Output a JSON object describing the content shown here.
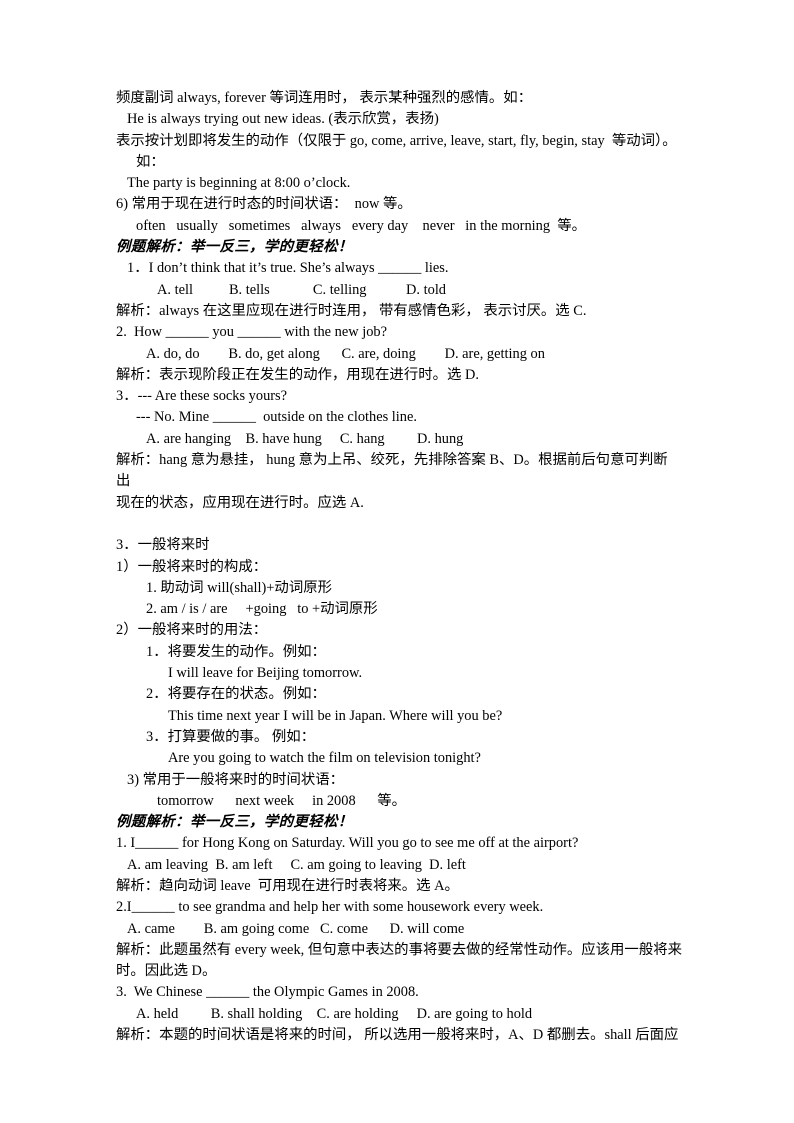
{
  "document": {
    "language": "zh-CN + en",
    "lines": [
      {
        "id": "l01",
        "indent": 0,
        "style": "normal",
        "text": "频度副词 always, forever 等词连用时， 表示某种强烈的感情。如："
      },
      {
        "id": "l02",
        "indent": 1,
        "style": "normal",
        "text": "He is always trying out new ideas. (表示欣赏，表扬)"
      },
      {
        "id": "l03",
        "indent": 0,
        "style": "normal",
        "text": "表示按计划即将发生的动作（仅限于 go, come, arrive, leave, start, fly, begin, stay  等动词）。"
      },
      {
        "id": "l04",
        "indent": 2,
        "style": "normal",
        "text": "如："
      },
      {
        "id": "l05",
        "indent": 1,
        "style": "normal",
        "text": "The party is beginning at 8:00 o’clock."
      },
      {
        "id": "l06",
        "indent": 0,
        "style": "normal",
        "text": "6) 常用于现在进行时态的时间状语：  now 等。"
      },
      {
        "id": "l07",
        "indent": 2,
        "style": "normal",
        "text": "often   usually   sometimes   always   every day    never   in the morning  等。"
      },
      {
        "id": "l08",
        "indent": 0,
        "style": "heading",
        "text": "例题解析：举一反三，学的更轻松！"
      },
      {
        "id": "l09",
        "indent": 1,
        "style": "normal",
        "text": "1．I don’t think that it’s true. She’s always ______ lies."
      },
      {
        "id": "l10",
        "indent": 4,
        "style": "normal",
        "text": "A. tell          B. tells            C. telling           D. told"
      },
      {
        "id": "l11",
        "indent": 0,
        "style": "normal",
        "text": "解析：always 在这里应现在进行时连用， 带有感情色彩， 表示讨厌。选 C."
      },
      {
        "id": "l12",
        "indent": 0,
        "style": "normal",
        "text": "2.  How ______ you ______ with the new job?"
      },
      {
        "id": "l13",
        "indent": 3,
        "style": "normal",
        "text": "A. do, do        B. do, get along      C. are, doing        D. are, getting on"
      },
      {
        "id": "l14",
        "indent": 0,
        "style": "normal",
        "text": "解析：表示现阶段正在发生的动作，用现在进行时。选 D."
      },
      {
        "id": "l15",
        "indent": 0,
        "style": "normal",
        "text": "3．--- Are these socks yours?"
      },
      {
        "id": "l16",
        "indent": 2,
        "style": "normal",
        "text": "--- No. Mine ______  outside on the clothes line."
      },
      {
        "id": "l17",
        "indent": 3,
        "style": "normal",
        "text": "A. are hanging    B. have hung     C. hang         D. hung"
      },
      {
        "id": "l18",
        "indent": 0,
        "style": "normal",
        "text": "解析：hang 意为悬挂， hung 意为上吊、绞死，先排除答案 B、D。根据前后句意可判断出"
      },
      {
        "id": "l19",
        "indent": 0,
        "style": "normal",
        "text": "现在的状态，应用现在进行时。应选 A."
      },
      {
        "id": "l20",
        "indent": 0,
        "style": "blank",
        "text": ""
      },
      {
        "id": "l21",
        "indent": 0,
        "style": "normal",
        "text": "3．一般将来时"
      },
      {
        "id": "l22",
        "indent": 0,
        "style": "normal",
        "text": "1）一般将来时的构成："
      },
      {
        "id": "l23",
        "indent": 3,
        "style": "normal",
        "text": "1. 助动词 will(shall)+动词原形"
      },
      {
        "id": "l24",
        "indent": 3,
        "style": "normal",
        "text": "2. am / is / are     +going   to +动词原形"
      },
      {
        "id": "l25",
        "indent": 0,
        "style": "normal",
        "text": "2）一般将来时的用法："
      },
      {
        "id": "l26",
        "indent": 3,
        "style": "normal",
        "text": "1．将要发生的动作。例如："
      },
      {
        "id": "l27",
        "indent": 5,
        "style": "normal",
        "text": "I will leave for Beijing tomorrow."
      },
      {
        "id": "l28",
        "indent": 3,
        "style": "normal",
        "text": "2．将要存在的状态。例如："
      },
      {
        "id": "l29",
        "indent": 5,
        "style": "normal",
        "text": "This time next year I will be in Japan. Where will you be?"
      },
      {
        "id": "l30",
        "indent": 3,
        "style": "normal",
        "text": "3．打算要做的事。 例如："
      },
      {
        "id": "l31",
        "indent": 5,
        "style": "normal",
        "text": "Are you going to watch the film on television tonight?"
      },
      {
        "id": "l32",
        "indent": 1,
        "style": "normal",
        "text": "3) 常用于一般将来时的时间状语："
      },
      {
        "id": "l33",
        "indent": 4,
        "style": "normal",
        "text": "tomorrow      next week     in 2008      等。"
      },
      {
        "id": "l34",
        "indent": 0,
        "style": "heading",
        "text": "例题解析：举一反三，学的更轻松！"
      },
      {
        "id": "l35",
        "indent": 0,
        "style": "normal",
        "text": "1. I______ for Hong Kong on Saturday. Will you go to see me off at the airport?"
      },
      {
        "id": "l36",
        "indent": 1,
        "style": "normal",
        "text": "A. am leaving  B. am left     C. am going to leaving  D. left"
      },
      {
        "id": "l37",
        "indent": 0,
        "style": "normal",
        "text": "解析：趋向动词 leave  可用现在进行时表将来。选 A。"
      },
      {
        "id": "l38",
        "indent": 0,
        "style": "normal",
        "text": "2.I______ to see grandma and help her with some housework every week."
      },
      {
        "id": "l39",
        "indent": 1,
        "style": "normal",
        "text": "A. came        B. am going come   C. come      D. will come"
      },
      {
        "id": "l40",
        "indent": 0,
        "style": "normal",
        "text": "解析：此题虽然有 every week, 但句意中表达的事将要去做的经常性动作。应该用一般将来"
      },
      {
        "id": "l41",
        "indent": 0,
        "style": "normal",
        "text": "时。因此选 D。"
      },
      {
        "id": "l42",
        "indent": 0,
        "style": "normal",
        "text": "3.  We Chinese ______ the Olympic Games in 2008."
      },
      {
        "id": "l43",
        "indent": 2,
        "style": "normal",
        "text": "A. held         B. shall holding    C. are holding     D. are going to hold"
      },
      {
        "id": "l44",
        "indent": 0,
        "style": "normal",
        "text": "解析：本题的时间状语是将来的时间， 所以选用一般将来时，A、D 都删去。shall 后面应"
      }
    ]
  }
}
